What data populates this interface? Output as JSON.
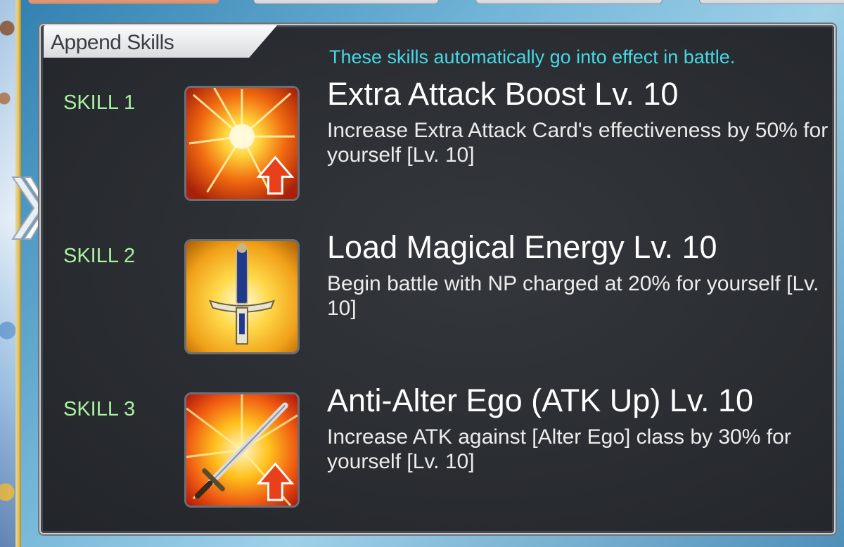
{
  "panel": {
    "title": "Append Skills",
    "subtitle": "These skills automatically go into effect in battle."
  },
  "skills": [
    {
      "label": "SKILL 1",
      "name": "Extra Attack Boost Lv. 10",
      "description": "Increase Extra Attack Card's effectiveness by 50% for yourself [Lv. 10]",
      "icon": "extra-attack-burst-icon"
    },
    {
      "label": "SKILL 2",
      "name": "Load Magical Energy Lv. 10",
      "description": "Begin battle with NP charged at 20% for yourself [Lv. 10]",
      "icon": "sword-np-charge-icon"
    },
    {
      "label": "SKILL 3",
      "name": "Anti-Alter Ego (ATK Up) Lv. 10",
      "description": "Increase ATK against [Alter Ego] class by 30% for yourself [Lv. 10]",
      "icon": "sword-atk-up-icon"
    }
  ],
  "colors": {
    "subtitle": "#47d7e6",
    "skill_label": "#a9f0a0",
    "panel_bg": "#2a2d31",
    "up_arrow": "#e8401a"
  }
}
